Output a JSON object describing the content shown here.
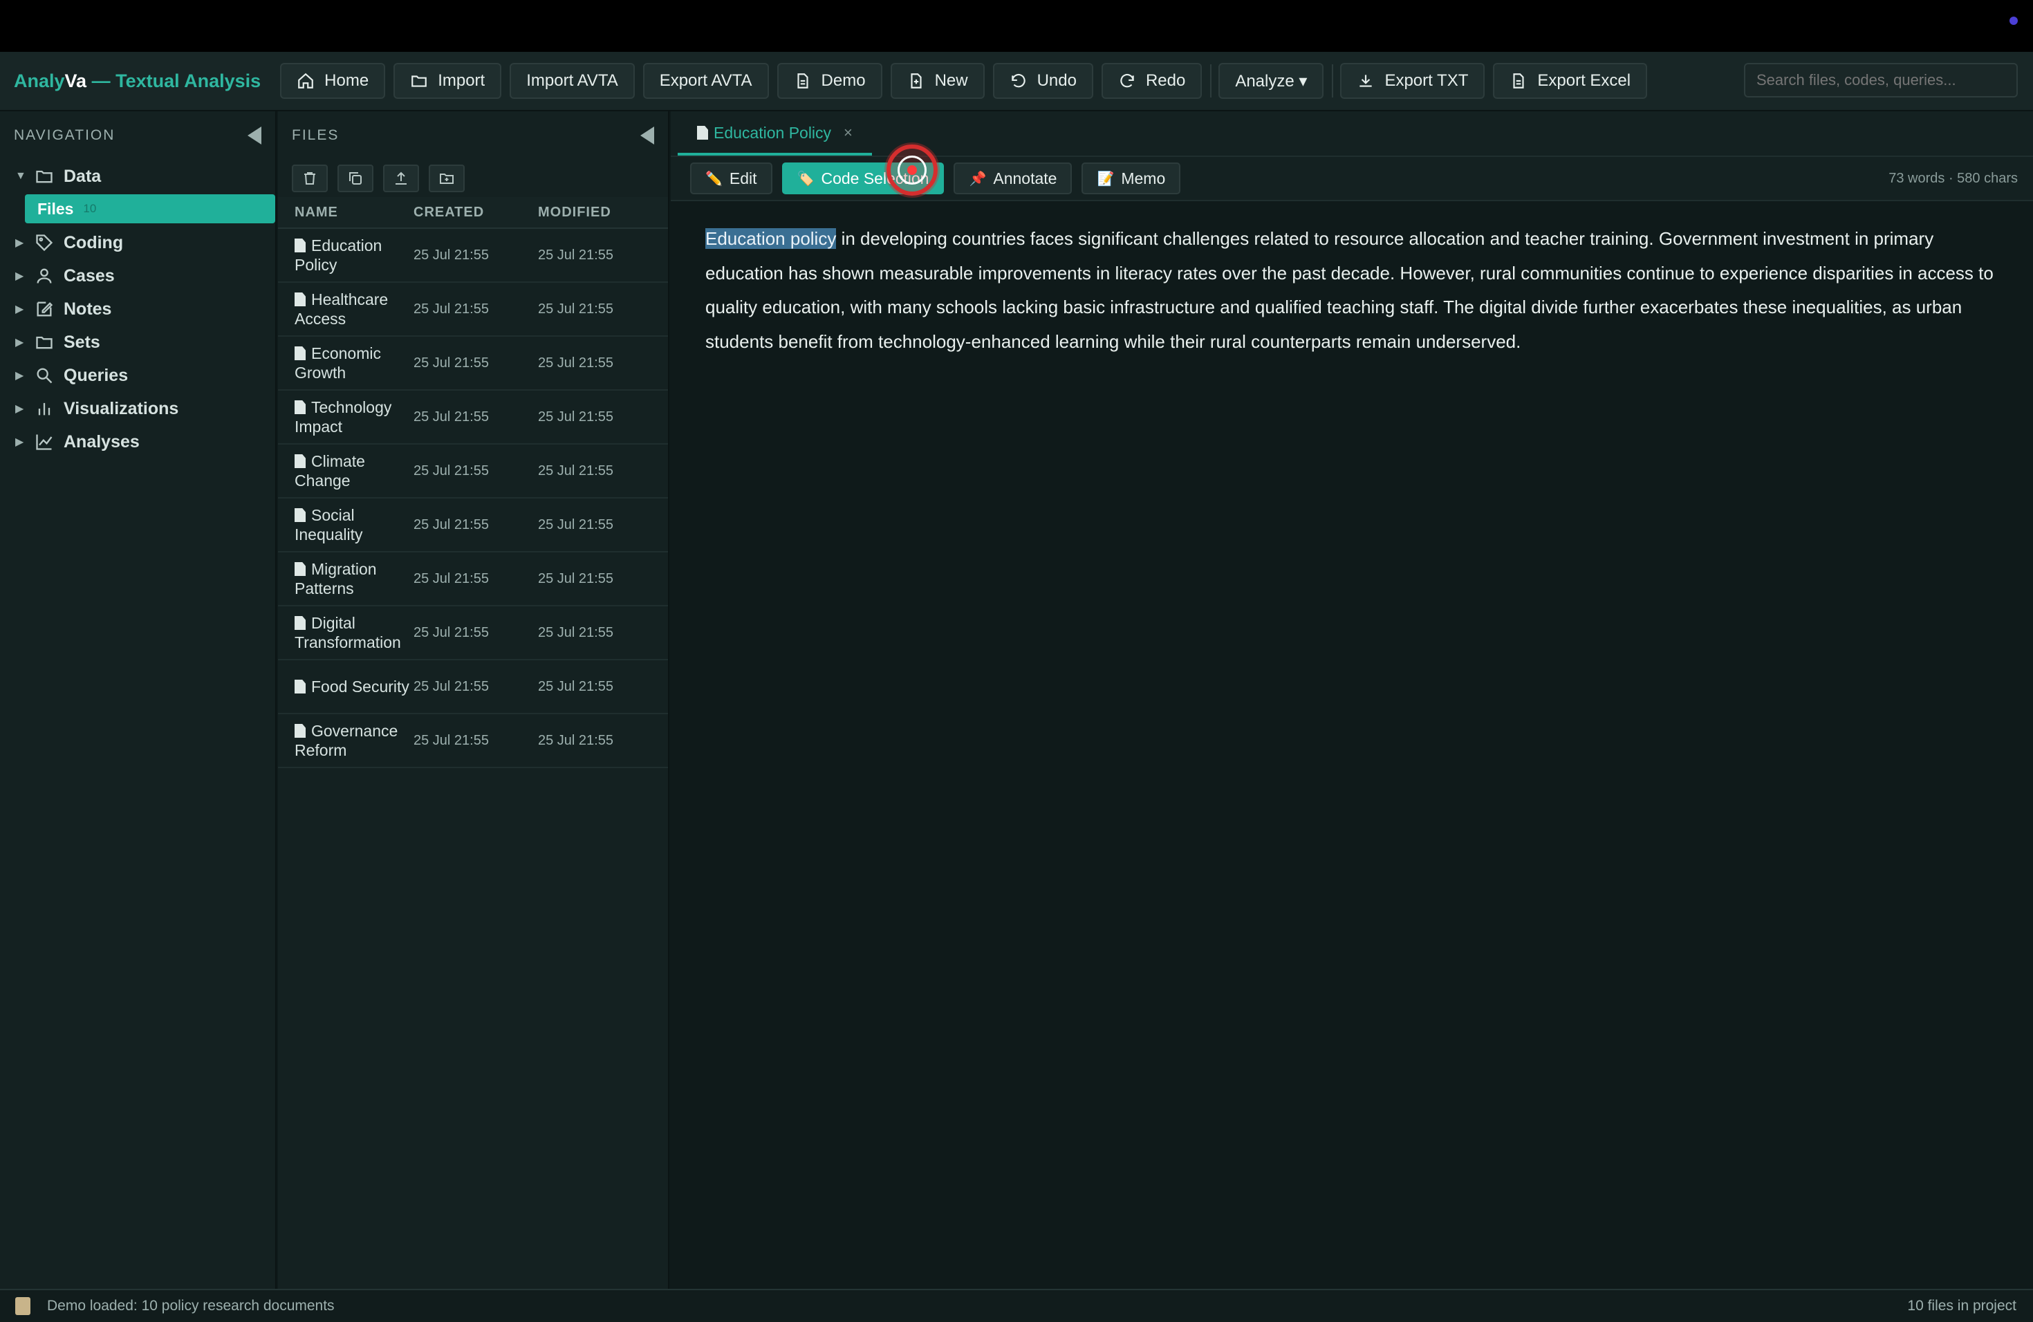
{
  "app": {
    "title_prefix": "Analy",
    "title_va": "Va",
    "title_suffix": " — Textual Analysis"
  },
  "toolbar": {
    "home": "Home",
    "import": "Import",
    "import_avta": "Import AVTA",
    "export_avta": "Export AVTA",
    "demo": "Demo",
    "new": "New",
    "undo": "Undo",
    "redo": "Redo",
    "analyze": "Analyze ▾",
    "export_txt": "Export TXT",
    "export_excel": "Export Excel",
    "search_placeholder": "Search files, codes, queries..."
  },
  "navigation": {
    "header": "NAVIGATION",
    "items": [
      {
        "label": "Data",
        "expanded": true,
        "icon": "folder-icon"
      },
      {
        "label": "Coding",
        "icon": "tag-icon"
      },
      {
        "label": "Cases",
        "icon": "user-icon"
      },
      {
        "label": "Notes",
        "icon": "edit-icon"
      },
      {
        "label": "Sets",
        "icon": "folder-icon"
      },
      {
        "label": "Queries",
        "icon": "search-icon"
      },
      {
        "label": "Visualizations",
        "icon": "bar-chart-icon"
      },
      {
        "label": "Analyses",
        "icon": "line-chart-icon"
      }
    ],
    "files_item": {
      "label": "Files",
      "count": "10"
    }
  },
  "files": {
    "header": "FILES",
    "columns": [
      "NAME",
      "CREATED",
      "MODIFIED"
    ],
    "rows": [
      {
        "name": "Education Policy",
        "created": "25 Jul 21:55",
        "modified": "25 Jul 21:55"
      },
      {
        "name": "Healthcare Access",
        "created": "25 Jul 21:55",
        "modified": "25 Jul 21:55"
      },
      {
        "name": "Economic Growth",
        "created": "25 Jul 21:55",
        "modified": "25 Jul 21:55"
      },
      {
        "name": "Technology Impact",
        "created": "25 Jul 21:55",
        "modified": "25 Jul 21:55"
      },
      {
        "name": "Climate Change",
        "created": "25 Jul 21:55",
        "modified": "25 Jul 21:55"
      },
      {
        "name": "Social Inequality",
        "created": "25 Jul 21:55",
        "modified": "25 Jul 21:55"
      },
      {
        "name": "Migration Patterns",
        "created": "25 Jul 21:55",
        "modified": "25 Jul 21:55"
      },
      {
        "name": "Digital Transformation",
        "created": "25 Jul 21:55",
        "modified": "25 Jul 21:55"
      },
      {
        "name": "Food Security",
        "created": "25 Jul 21:55",
        "modified": "25 Jul 21:55"
      },
      {
        "name": "Governance Reform",
        "created": "25 Jul 21:55",
        "modified": "25 Jul 21:55"
      }
    ]
  },
  "editor": {
    "tab_label": "Education Policy",
    "buttons": {
      "edit": "Edit",
      "code_selection": "Code Selection",
      "annotate": "Annotate",
      "memo": "Memo"
    },
    "stats": "73 words · 580 chars",
    "highlighted": "Education policy",
    "body": " in developing countries faces significant challenges related to resource allocation and teacher training. Government investment in primary education has shown measurable improvements in literacy rates over the past decade. However, rural communities continue to experience disparities in access to quality education, with many schools lacking basic infrastructure and qualified teaching staff. The digital divide further exacerbates these inequalities, as urban students benefit from technology-enhanced learning while their rural counterparts remain underserved."
  },
  "status": {
    "left": "Demo loaded: 10 policy research documents",
    "right": "10 files in project"
  },
  "colors": {
    "accent": "#20b09a",
    "highlight": "#3a6f93",
    "background": "#0f1a1a"
  }
}
